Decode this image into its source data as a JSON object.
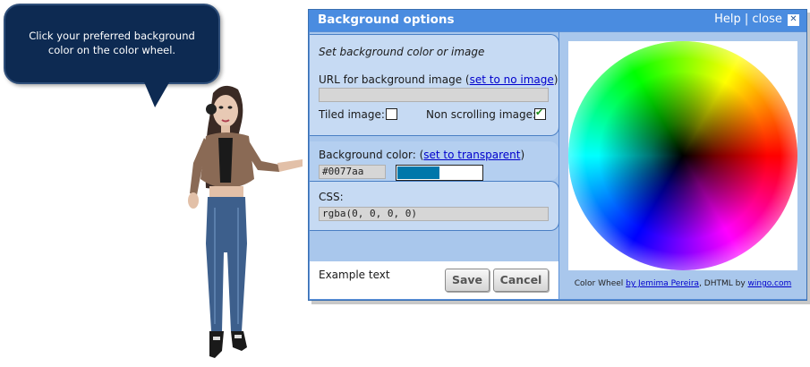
{
  "bubble": {
    "text": "Click your preferred background color on the color wheel."
  },
  "dialog": {
    "title": "Background options",
    "help": "Help",
    "separator": "|",
    "close": "close",
    "close_icon": "close-x-icon"
  },
  "image_section": {
    "heading": "Set background color or image",
    "url_label": "URL for background image (",
    "set_no_image": "set to no image",
    "paren_close": ")",
    "url_value": "",
    "tiled_label": "Tiled image:",
    "tiled_checked": false,
    "nonscroll_label": "Non scrolling image:",
    "nonscroll_checked": true
  },
  "color_section": {
    "label": "Background color: (",
    "set_transparent": "set to transparent",
    "paren_close": ")",
    "value": "#0077aa",
    "swatch_color": "#0077aa"
  },
  "css_section": {
    "label": "CSS:",
    "value": "rgba(0, 0, 0, 0)"
  },
  "example": {
    "text": "Example text"
  },
  "buttons": {
    "save": "Save",
    "cancel": "Cancel"
  },
  "credit": {
    "prefix": "Color Wheel ",
    "author_link": "by Jemima Pereira",
    "middle": ", DHTML by ",
    "site_link": "wingo.com"
  }
}
